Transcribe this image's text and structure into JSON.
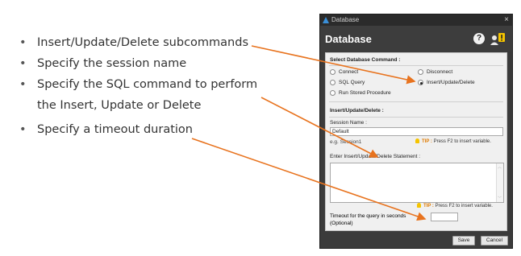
{
  "bullets": [
    "Insert/Update/Delete subcommands",
    "Specify the session name",
    "Specify the SQL command to perform the Insert, Update or Delete",
    "Specify a timeout duration"
  ],
  "window": {
    "title": "Database",
    "header": "Database",
    "close_glyph": "×",
    "help_glyph": "?"
  },
  "commands": {
    "heading": "Select Database Command :",
    "options": [
      "Connect",
      "Disconnect",
      "SQL Query",
      "Insert/Update/Delete",
      "Run Stored Procedure"
    ],
    "selected": "Insert/Update/Delete"
  },
  "section": {
    "heading": "Insert/Update/Delete :",
    "session_label": "Session Name :",
    "session_value": "Default",
    "session_hint": "e.g. Session1",
    "tip_word": "TIP :",
    "tip_text": "Press F2 to insert variable.",
    "statement_label": "Enter Insert/Update/Delete Statement :",
    "timeout_label_1": "Timeout for the query in seconds",
    "timeout_label_2": "(Optional)"
  },
  "buttons": {
    "save": "Save",
    "cancel": "Cancel"
  },
  "colors": {
    "arrow": "#e8731e",
    "dialog_dark": "#3b3b3b",
    "tip": "#e07b00",
    "bulb": "#f5c400"
  }
}
